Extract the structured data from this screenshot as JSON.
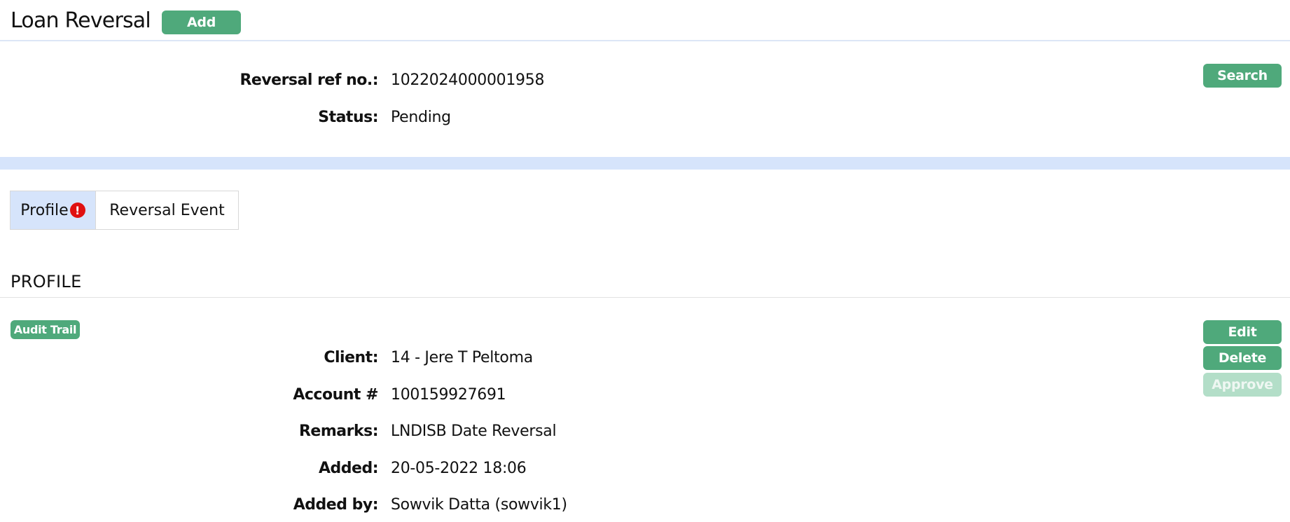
{
  "header": {
    "title": "Loan Reversal",
    "add_label": "Add"
  },
  "search": {
    "button_label": "Search",
    "fields": [
      {
        "label": "Reversal ref no.:",
        "value": "1022024000001958"
      },
      {
        "label": "Status:",
        "value": "Pending"
      }
    ]
  },
  "tabs": [
    {
      "label": "Profile"
    },
    {
      "label": "Reversal Event"
    }
  ],
  "tab_alert_symbol": "!",
  "profile": {
    "section_title": "PROFILE",
    "audit_trail_label": "Audit Trail",
    "actions": {
      "edit": "Edit",
      "delete": "Delete",
      "approve": "Approve"
    },
    "fields": [
      {
        "label": "Client:",
        "value": "14 - Jere T Peltoma"
      },
      {
        "label": "Account #",
        "value": "100159927691"
      },
      {
        "label": "Remarks:",
        "value": "LNDISB Date Reversal"
      },
      {
        "label": "Added:",
        "value": "20-05-2022 18:06"
      },
      {
        "label": "Added by:",
        "value": "Sowvik Datta (sowvik1)"
      }
    ]
  },
  "colors": {
    "button_green": "#4fa97b",
    "button_disabled": "#b3dec8",
    "tab_active_bg": "#d6e4fb",
    "band_blue": "#d6e4fb",
    "alert_red": "#e01010"
  }
}
